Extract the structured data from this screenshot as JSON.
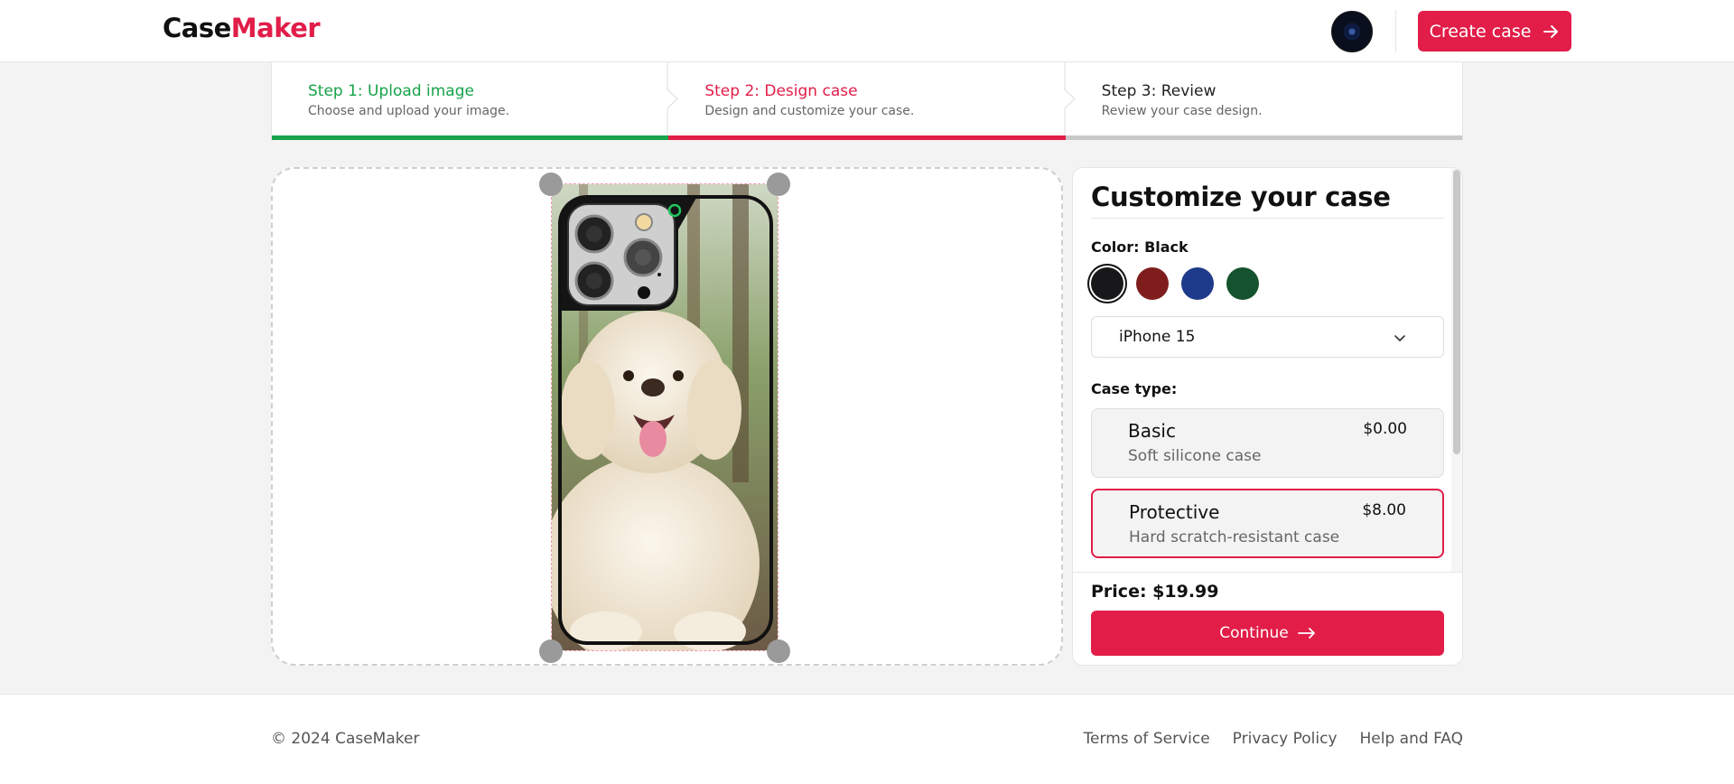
{
  "header": {
    "logo_part1": "Case",
    "logo_part2": "Maker",
    "create_button": "Create case"
  },
  "steps": [
    {
      "title": "Step 1: Upload image",
      "subtitle": "Choose and upload your image.",
      "status": "complete"
    },
    {
      "title": "Step 2: Design case",
      "subtitle": "Design and customize your case.",
      "status": "current"
    },
    {
      "title": "Step 3: Review",
      "subtitle": "Review your case design.",
      "status": "upcoming"
    }
  ],
  "customize": {
    "title": "Customize your case",
    "color_label": "Color: Black",
    "colors": [
      {
        "name": "Black",
        "hex": "#18181b",
        "selected": true
      },
      {
        "name": "Red",
        "hex": "#7f1d1d",
        "selected": false
      },
      {
        "name": "Blue",
        "hex": "#1e3a8a",
        "selected": false
      },
      {
        "name": "Green",
        "hex": "#14532d",
        "selected": false
      }
    ],
    "model": "iPhone 15",
    "case_type_label": "Case type:",
    "case_types": [
      {
        "name": "Basic",
        "description": "Soft silicone case",
        "price": "$0.00",
        "selected": false
      },
      {
        "name": "Protective",
        "description": "Hard scratch-resistant case",
        "price": "$8.00",
        "selected": true
      }
    ],
    "price": "Price: $19.99",
    "continue_button": "Continue"
  },
  "footer": {
    "copyright": "© 2024 CaseMaker",
    "links": [
      "Terms of Service",
      "Privacy Policy",
      "Help and FAQ"
    ]
  },
  "colors": {
    "accent": "#e11d48",
    "success": "#16a34a"
  }
}
